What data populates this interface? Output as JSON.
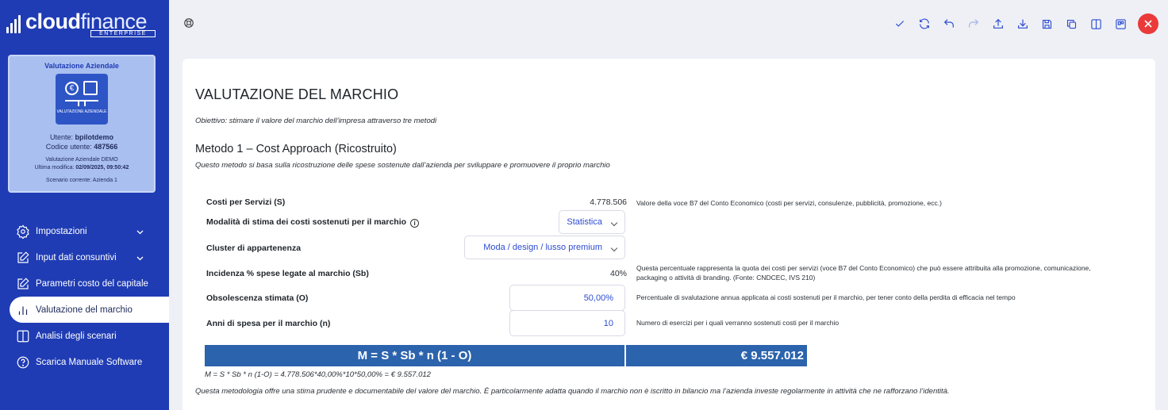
{
  "brand": {
    "name_bold": "cloud",
    "name_thin": "finance",
    "edition": "ENTERPRISE"
  },
  "profile_card": {
    "title": "Valutazione Aziendale",
    "icon_caption": "VALUTAZIONE AZIENDALE",
    "user_label": "Utente: ",
    "user_value": "bpilotdemo",
    "code_label": "Codice utente: ",
    "code_value": "487566",
    "project": "Valutazione Aziendale DEMO",
    "modified_label": "Ultima modifica: ",
    "modified_value": "02/09/2025, 09:50:42",
    "scenario": "Scenario corrente: Azienda 1"
  },
  "nav": {
    "items": [
      {
        "label": "Impostazioni",
        "icon": "gear-icon",
        "has_chevron": true
      },
      {
        "label": "Input dati consuntivi",
        "icon": "edit-icon",
        "has_chevron": true
      },
      {
        "label": "Parametri costo del capitale",
        "icon": "edit-icon",
        "has_chevron": false
      },
      {
        "label": "Valutazione del marchio",
        "icon": "bar-chart-icon",
        "has_chevron": false,
        "active": true
      },
      {
        "label": "Analisi degli scenari",
        "icon": "columns-icon",
        "has_chevron": false
      },
      {
        "label": "Scarica Manuale Software",
        "icon": "help-circle-icon",
        "has_chevron": false
      }
    ]
  },
  "toolbar": {
    "icons": [
      "check-icon",
      "refresh-icon",
      "undo-icon",
      "redo-icon",
      "upload-icon",
      "download-icon",
      "save-icon",
      "copy-icon",
      "split-view-icon",
      "layout-icon",
      "close-icon"
    ],
    "accent_color": "#2d4bd0",
    "close_color": "#ea3a3a"
  },
  "main": {
    "title": "VALUTAZIONE DEL MARCHIO",
    "objective": "Obiettivo: stimare il valore del marchio dell’impresa attraverso tre metodi",
    "method_title": "Metodo 1 – Cost Approach (Ricostruito)",
    "method_desc": "Questo metodo si basa sulla ricostruzione delle spese sostenute dall’azienda per sviluppare e promuovere il proprio marchio",
    "rows": {
      "costi_label": "Costi per Servizi (S)",
      "costi_value": "4.778.506",
      "costi_note": "Valore della voce B7 del Conto Economico (costi per servizi, consulenze, pubblicità, promozione, ecc.)",
      "modalita_label": "Modalità di stima dei costi sostenuti per il marchio",
      "modalita_value": "Statistica",
      "cluster_label": "Cluster di appartenenza",
      "cluster_value": "Moda / design / lusso premium",
      "incidenza_label": "Incidenza % spese legate al marchio (Sb)",
      "incidenza_value": "40%",
      "incidenza_note_1": "Questa percentuale rappresenta la quota dei costi per servizi (voce B7 del Conto Economico) che può essere attribuita alla promozione, comunicazione,",
      "incidenza_note_2": "packaging o attività di branding. (Fonte: CNDCEC, IVS 210)",
      "obsolescenza_label": "Obsolescenza stimata (O)",
      "obsolescenza_value": "50,00%",
      "obsolescenza_note": "Percentuale di svalutazione annua applicata ai costi sostenuti per il marchio, per tener conto della perdita di efficacia nel tempo",
      "anni_label": "Anni di spesa per il marchio (n)",
      "anni_value": "10",
      "anni_note": "Numero di esercizi per i quali verranno sostenuti costi per il marchio"
    },
    "formula": "M = S * Sb * n (1 - O)",
    "result": "€ 9.557.012",
    "calc": "M = S * Sb * n (1-O) = 4.778.506*40,00%*10*50,00% = € 9.557.012",
    "closing": "Questa metodologia offre una stima prudente e documentabile del valore del marchio. È particolarmente adatta quando il marchio non è iscritto in bilancio ma l’azienda investe regolarmente in attività che ne rafforzano l’identità."
  }
}
